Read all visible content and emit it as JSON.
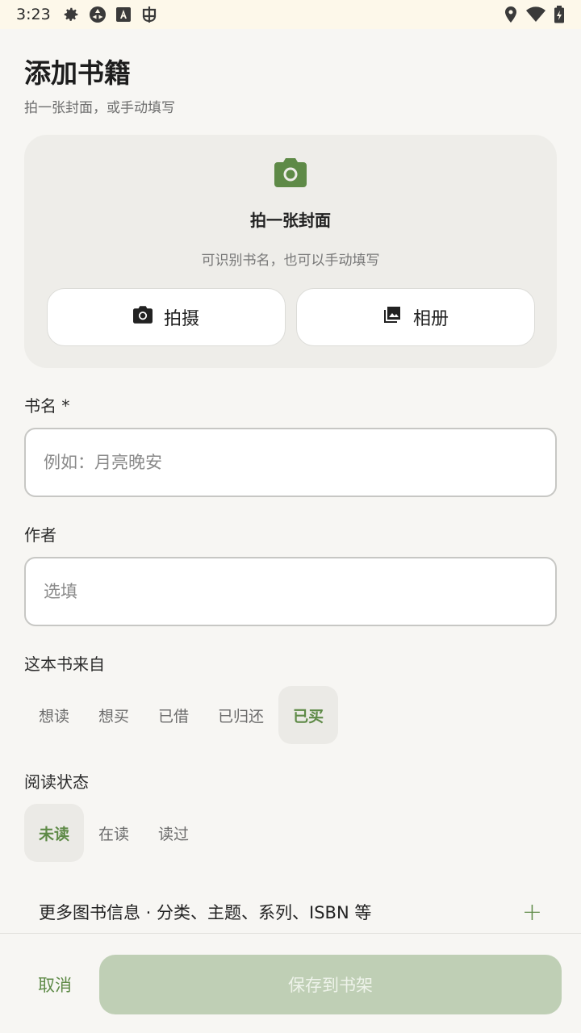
{
  "status_bar": {
    "time": "3:23",
    "icons": [
      "gear-icon",
      "app-icon",
      "keyboard-icon",
      "bug-icon",
      "location-icon",
      "wifi-icon",
      "battery-icon"
    ]
  },
  "header": {
    "title": "添加书籍",
    "subtitle": "拍一张封面，或手动填写"
  },
  "cover": {
    "icon": "camera-icon",
    "heading": "拍一张封面",
    "hint": "可识别书名，也可以手动填写",
    "shoot_label": "拍摄",
    "album_label": "相册"
  },
  "form": {
    "title_label": "书名 *",
    "title_placeholder": "例如：月亮晚安",
    "author_label": "作者",
    "author_placeholder": "选填",
    "source_label": "这本书来自",
    "source_options": [
      "想读",
      "想买",
      "已借",
      "已归还",
      "已买"
    ],
    "source_selected": "已买",
    "status_label": "阅读状态",
    "status_options": [
      "未读",
      "在读",
      "读过"
    ],
    "status_selected": "未读",
    "more_info": "更多图书信息 · 分类、主题、系列、ISBN 等",
    "more_icon": "+"
  },
  "actions": {
    "cancel": "取消",
    "save": "保存到书架"
  },
  "colors": {
    "accent": "#5e8a47",
    "save_disabled": "#bfcfb5",
    "card_bg": "#eeede9",
    "page_bg": "#f7f6f3"
  }
}
